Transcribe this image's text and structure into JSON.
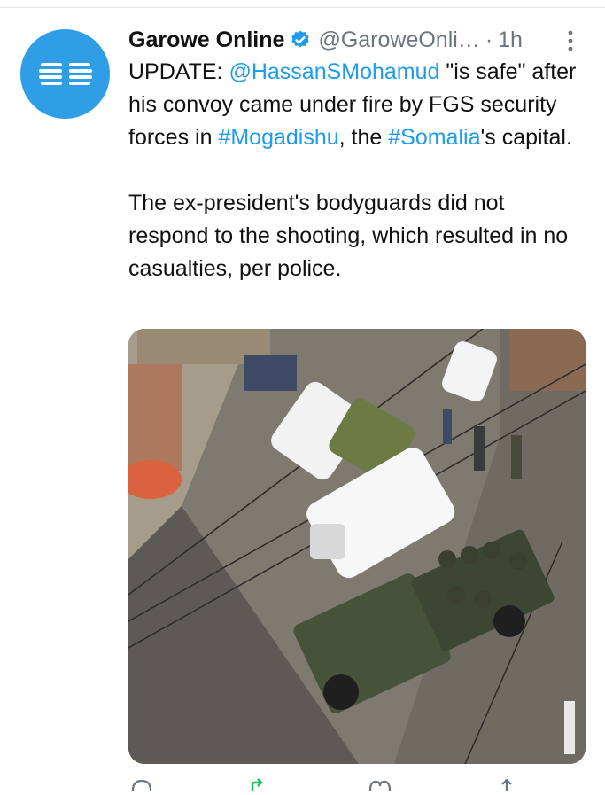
{
  "tweet": {
    "author_name": "Garowe Online",
    "handle": "@GaroweOnli…",
    "separator": "·",
    "time": "1h",
    "text_update_prefix": "UPDATE: ",
    "mention": "@HassanSMohamud",
    "text_1": " \"is safe\" after his convoy came under fire by FGS security forces in ",
    "hashtag_1": "#Mogadishu",
    "text_2": ", the ",
    "hashtag_2": "#Somalia",
    "text_3": "'s capital.",
    "paragraph_2": "The ex-president's bodyguards did not respond to the shooting, which resulted in no casualties, per police."
  },
  "icons": {
    "avatar": "garowe-online-logo",
    "verified": "verified-badge-icon",
    "more": "more-vertical-icon",
    "reply": "reply-icon",
    "retweet": "retweet-icon",
    "like": "heart-icon",
    "share": "share-icon"
  },
  "colors": {
    "accent": "#1d9bf0",
    "avatar_bg": "#2f9ee6",
    "muted": "#6b7580"
  }
}
